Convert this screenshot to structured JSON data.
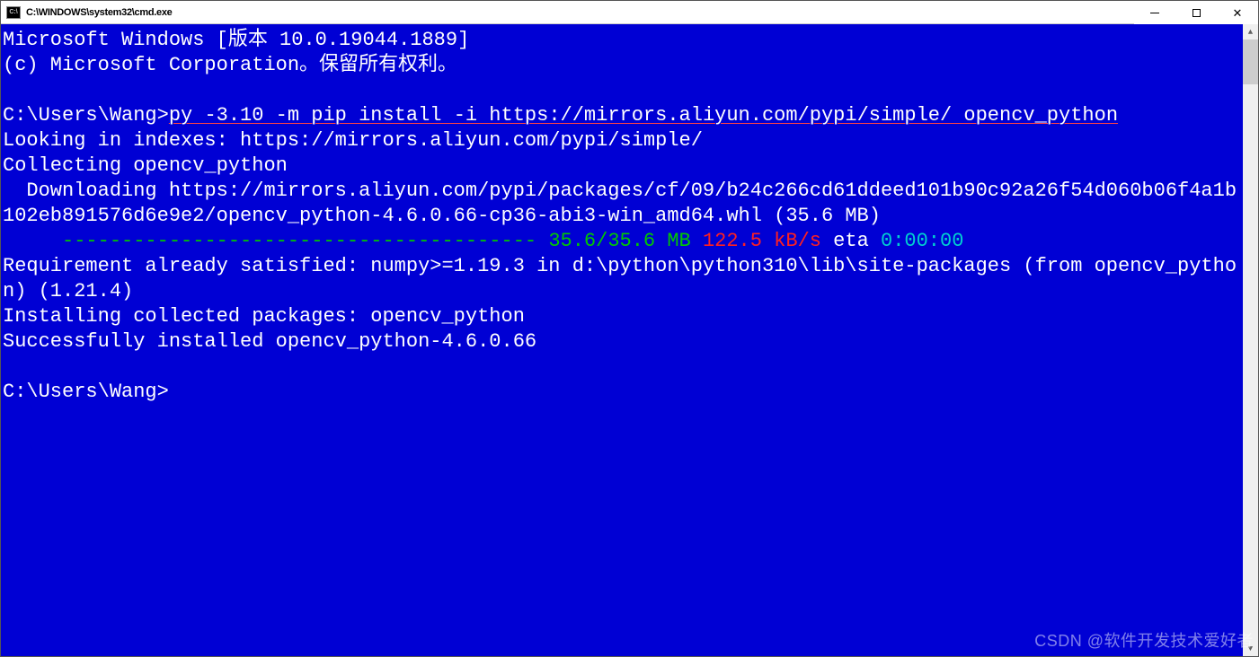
{
  "titlebar": {
    "title": "C:\\WINDOWS\\system32\\cmd.exe"
  },
  "terminal": {
    "header1": "Microsoft Windows [版本 10.0.19044.1889]",
    "header2": "(c) Microsoft Corporation。保留所有权利。",
    "prompt1": "C:\\Users\\Wang>",
    "command1": "py -3.10 -m pip install -i https://mirrors.aliyun.com/pypi/simple/ opencv_python",
    "line_indexes": "Looking in indexes: https://mirrors.aliyun.com/pypi/simple/",
    "line_collecting": "Collecting opencv_python",
    "line_downloading": "  Downloading https://mirrors.aliyun.com/pypi/packages/cf/09/b24c266cd61ddeed101b90c92a26f54d060b06f4a1b102eb891576d6e9e2/opencv_python-4.6.0.66-cp36-abi3-win_amd64.whl (35.6 MB)",
    "progress_indent": "     ",
    "progress_dashes": "---------------------------------------- ",
    "progress_mb": "35.6/35.6 MB",
    "progress_speed": " 122.5 kB/s",
    "progress_eta_label": " eta ",
    "progress_eta_time": "0:00:00",
    "line_requirement": "Requirement already satisfied: numpy>=1.19.3 in d:\\python\\python310\\lib\\site-packages (from opencv_python) (1.21.4)",
    "line_installing": "Installing collected packages: opencv_python",
    "line_success": "Successfully installed opencv_python-4.6.0.66",
    "prompt2": "C:\\Users\\Wang>"
  },
  "watermark": "CSDN @软件开发技术爱好者"
}
